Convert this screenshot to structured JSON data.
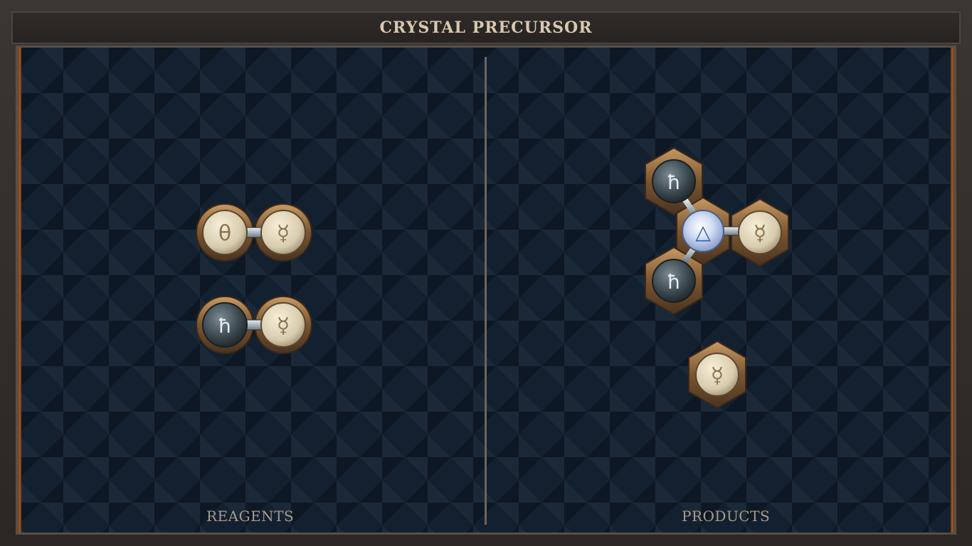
{
  "title": "CRYSTAL PRECURSOR",
  "sections": {
    "reagents_label": "REAGENTS",
    "products_label": "PRODUCTS"
  },
  "atoms": {
    "salt": "θ",
    "quicksilver": "☿",
    "lead": "ħ",
    "air": "△"
  },
  "colors": {
    "light_orb": "#e7dcc3",
    "dark_orb": "#3f4b52",
    "air_orb": "#c8d8f0",
    "copper_rim": "#8a6238"
  }
}
